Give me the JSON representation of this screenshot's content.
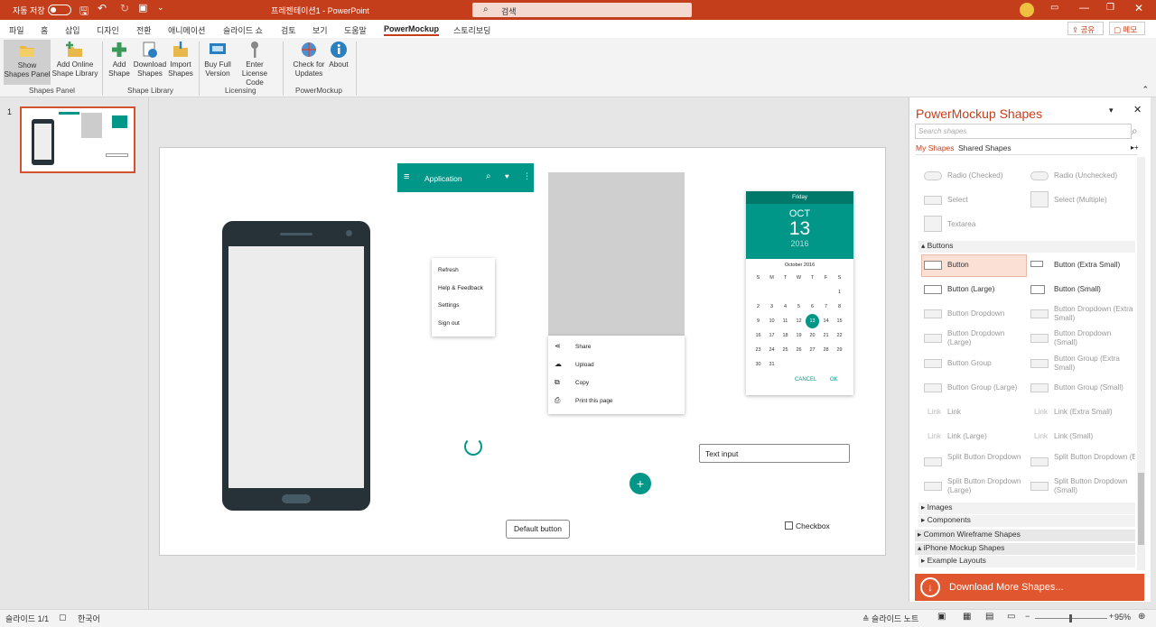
{
  "titlebar": {
    "autosave": "자동 저장",
    "doc_title": "프레젠테이션1  -  PowerPoint",
    "search_placeholder": "검색"
  },
  "tabs": [
    "파일",
    "홈",
    "삽입",
    "디자인",
    "전환",
    "애니메이션",
    "슬라이드 쇼",
    "검토",
    "보기",
    "도움말",
    "PowerMockup",
    "스토리보딩"
  ],
  "share_label": "공유",
  "comments_label": "메모",
  "ribbon": {
    "buttons": [
      {
        "l1": "Show",
        "l2": "Shapes Panel"
      },
      {
        "l1": "Add Online",
        "l2": "Shape Library"
      },
      {
        "l1": "Add",
        "l2": "Shape"
      },
      {
        "l1": "Download",
        "l2": "Shapes"
      },
      {
        "l1": "Import",
        "l2": "Shapes"
      },
      {
        "l1": "Buy Full",
        "l2": "Version"
      },
      {
        "l1": "Enter License",
        "l2": "Code"
      },
      {
        "l1": "Check for",
        "l2": "Updates"
      },
      {
        "l1": "About",
        "l2": ""
      }
    ],
    "groups": [
      "Shapes Panel",
      "Shape Library",
      "Licensing",
      "PowerMockup"
    ]
  },
  "slide_number": "1",
  "slide": {
    "appbar_title": "Application",
    "menu1": [
      "Refresh",
      "Help & Feedback",
      "Settings",
      "Sign out"
    ],
    "menu2": [
      "Share",
      "Upload",
      "Copy",
      "Print this page"
    ],
    "calendar": {
      "weekday": "Friday",
      "month": "OCT",
      "day": "13",
      "year": "2016",
      "title": "October 2016",
      "dow": [
        "S",
        "M",
        "T",
        "W",
        "T",
        "F",
        "S"
      ],
      "rows": [
        [
          "",
          "",
          "",
          "",
          "",
          "",
          "1"
        ],
        [
          "2",
          "3",
          "4",
          "5",
          "6",
          "7",
          "8"
        ],
        [
          "9",
          "10",
          "11",
          "12",
          "13",
          "14",
          "15"
        ],
        [
          "16",
          "17",
          "18",
          "19",
          "20",
          "21",
          "22"
        ],
        [
          "23",
          "24",
          "25",
          "26",
          "27",
          "28",
          "29"
        ],
        [
          "30",
          "31",
          "",
          "",
          "",
          "",
          ""
        ]
      ],
      "cancel": "CANCEL",
      "ok": "OK"
    },
    "text_input": "Text input",
    "default_button": "Default button",
    "checkbox": "Checkbox",
    "fab": "+"
  },
  "panel": {
    "title": "PowerMockup Shapes",
    "search_placeholder": "Search shapes",
    "tab_my": "My Shapes",
    "tab_shared": "Shared Shapes",
    "top_items": [
      [
        "Radio (Checked)",
        "Radio (Unchecked)"
      ],
      [
        "Select",
        "Select (Multiple)"
      ],
      [
        "Textarea",
        ""
      ]
    ],
    "buttons_section": "Buttons",
    "button_items": [
      [
        "Button",
        "Button (Extra Small)"
      ],
      [
        "Button (Large)",
        "Button (Small)"
      ],
      [
        "Button Dropdown",
        "Button Dropdown (Extra Small)"
      ],
      [
        "Button Dropdown (Large)",
        "Button Dropdown (Small)"
      ],
      [
        "Button Group",
        "Button Group (Extra Small)"
      ],
      [
        "Button Group (Large)",
        "Button Group (Small)"
      ],
      [
        "Link",
        "Link (Extra Small)"
      ],
      [
        "Link (Large)",
        "Link (Small)"
      ],
      [
        "Split Button Dropdown",
        "Split Button Dropdown  (Extra Sm..."
      ],
      [
        "Split Button Dropdown (Large)",
        "Split Button Dropdown (Small)"
      ]
    ],
    "sections": [
      "Images",
      "Components"
    ],
    "libraries": [
      "Common Wireframe Shapes",
      "iPhone Mockup Shapes",
      "Example Layouts"
    ],
    "download": "Download More Shapes..."
  },
  "status": {
    "slide": "슬라이드 1/1",
    "lang": "한국어",
    "notes": "슬라이드 노트",
    "zoom": "95%"
  },
  "colors": {
    "accent": "#c43e1c",
    "teal": "#009688",
    "phone": "#263238"
  }
}
